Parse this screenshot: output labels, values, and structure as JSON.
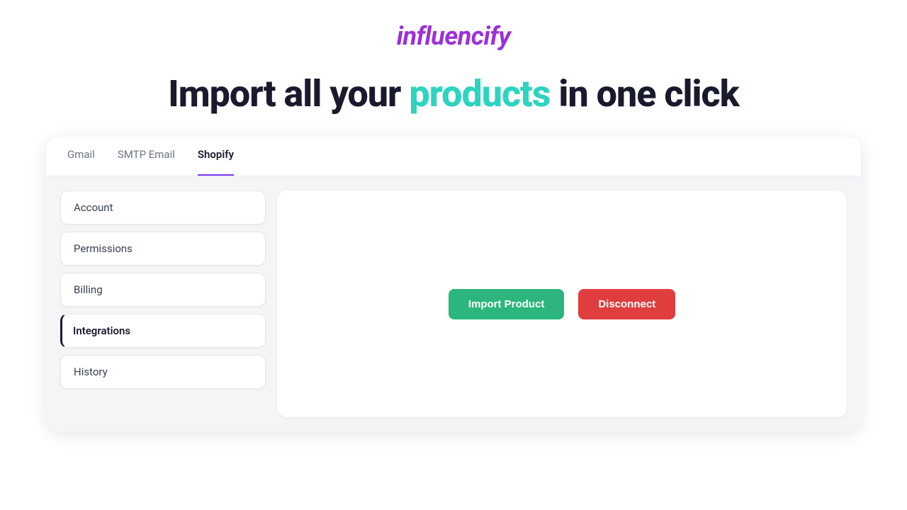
{
  "logo": {
    "text": "influencify"
  },
  "headline": {
    "prefix": "Import all your ",
    "highlight": "products",
    "suffix": " in one click"
  },
  "tabs": [
    {
      "id": "gmail",
      "label": "Gmail",
      "active": false
    },
    {
      "id": "smtp-email",
      "label": "SMTP Email",
      "active": false
    },
    {
      "id": "shopify",
      "label": "Shopify",
      "active": true
    }
  ],
  "sidebar": {
    "items": [
      {
        "id": "account",
        "label": "Account",
        "active": false
      },
      {
        "id": "permissions",
        "label": "Permissions",
        "active": false
      },
      {
        "id": "billing",
        "label": "Billing",
        "active": false
      },
      {
        "id": "integrations",
        "label": "Integrations",
        "active": true
      },
      {
        "id": "history",
        "label": "History",
        "active": false
      }
    ]
  },
  "buttons": {
    "import_product": "Import Product",
    "disconnect": "Disconnect"
  },
  "colors": {
    "logo": "#9b30d9",
    "highlight": "#2dd4bf",
    "active_tab_border": "#7c3aed",
    "import_btn": "#2cb67d",
    "disconnect_btn": "#e03e3e"
  }
}
